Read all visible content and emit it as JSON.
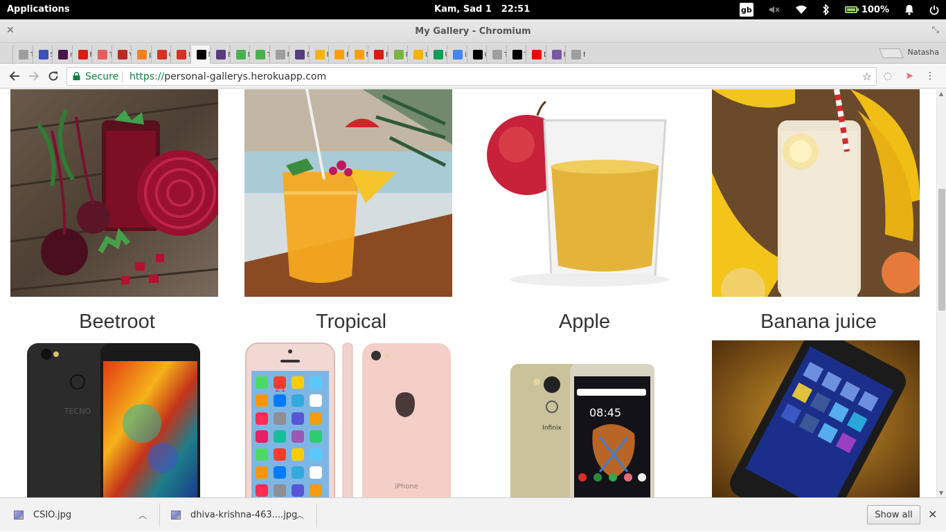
{
  "os_bar": {
    "applications_label": "Applications",
    "date": "Kam, Sad  1",
    "time": "22:51",
    "keyboard_layout": "gb",
    "battery_percent": "100%"
  },
  "window": {
    "title": "My Gallery - Chromium"
  },
  "tabs": [
    {
      "icon": "tree-icon",
      "letter": "T",
      "color": "#9e9e9e"
    },
    {
      "icon": "doc-icon",
      "letter": "S",
      "color": "#3f51b5"
    },
    {
      "icon": "hash-icon",
      "letter": "r",
      "color": "#4a154b"
    },
    {
      "icon": "angular-icon",
      "letter": "F",
      "color": "#dd1b16"
    },
    {
      "icon": "codepen-icon",
      "letter": "T",
      "color": "#e85d5d"
    },
    {
      "icon": "quora-icon",
      "letter": "V",
      "color": "#b92b27"
    },
    {
      "icon": "stack-icon",
      "letter": "p",
      "color": "#f48024"
    },
    {
      "icon": "gmail-icon",
      "letter": "C",
      "color": "#d93025"
    },
    {
      "icon": "gmail-icon",
      "letter": "Ir",
      "color": "#d93025"
    },
    {
      "icon": "medium-icon",
      "letter": "M",
      "color": "#000000",
      "active": true
    },
    {
      "icon": "bootstrap-icon",
      "letter": "E",
      "color": "#563d7c"
    },
    {
      "icon": "w3-icon",
      "letter": "F",
      "color": "#4caf50"
    },
    {
      "icon": "w3-icon",
      "letter": "T",
      "color": "#4caf50"
    },
    {
      "icon": "tree-icon",
      "letter": "F",
      "color": "#9e9e9e"
    },
    {
      "icon": "bootstrap-icon",
      "letter": "E",
      "color": "#563d7c"
    },
    {
      "icon": "globe-icon",
      "letter": "F",
      "color": "#f4b400"
    },
    {
      "icon": "fire-icon",
      "letter": "F",
      "color": "#ffa000"
    },
    {
      "icon": "fire-icon",
      "letter": "N",
      "color": "#ffa000"
    },
    {
      "icon": "angular-icon",
      "letter": "F",
      "color": "#dd1b16"
    },
    {
      "icon": "paint-icon",
      "letter": "F",
      "color": "#7cb342"
    },
    {
      "icon": "slides-icon",
      "letter": "U",
      "color": "#f4b400"
    },
    {
      "icon": "sheets-icon",
      "letter": "U",
      "color": "#0f9d58"
    },
    {
      "icon": "google-icon",
      "letter": "ir",
      "color": "#4285f4"
    },
    {
      "icon": "camera-icon",
      "letter": "C",
      "color": "#000000"
    },
    {
      "icon": "tree-icon",
      "letter": "T",
      "color": "#9e9e9e"
    },
    {
      "icon": "medium-icon",
      "letter": "T",
      "color": "#000000"
    },
    {
      "icon": "youtube-icon",
      "letter": "D",
      "color": "#ff0000"
    },
    {
      "icon": "heroku-icon",
      "letter": "F",
      "color": "#79589f"
    },
    {
      "icon": "page-icon",
      "letter": "F",
      "color": "#9e9e9e"
    }
  ],
  "profile_name": "Natasha",
  "toolbar": {
    "secure_label": "Secure",
    "url_scheme": "https://",
    "url_host": "personal-gallerys.herokuapp.com"
  },
  "gallery": {
    "row1": [
      "Beetroot",
      "Tropical",
      "Apple",
      "Banana juice"
    ]
  },
  "phone_texts": {
    "tecno_brand": "TECNO",
    "infinix_brand": "Infinix",
    "iphone_label": "iPhone",
    "infinix_clock": "08:45",
    "iphone_date": "21"
  },
  "downloads": {
    "items": [
      {
        "filename": "CSIO.jpg"
      },
      {
        "filename": "dhiva-krishna-463....jpg"
      }
    ],
    "show_all_label": "Show all"
  },
  "colors": {
    "secure_green": "#0b8043",
    "os_bar_bg": "#000000",
    "battery_green": "#9bd35a"
  }
}
